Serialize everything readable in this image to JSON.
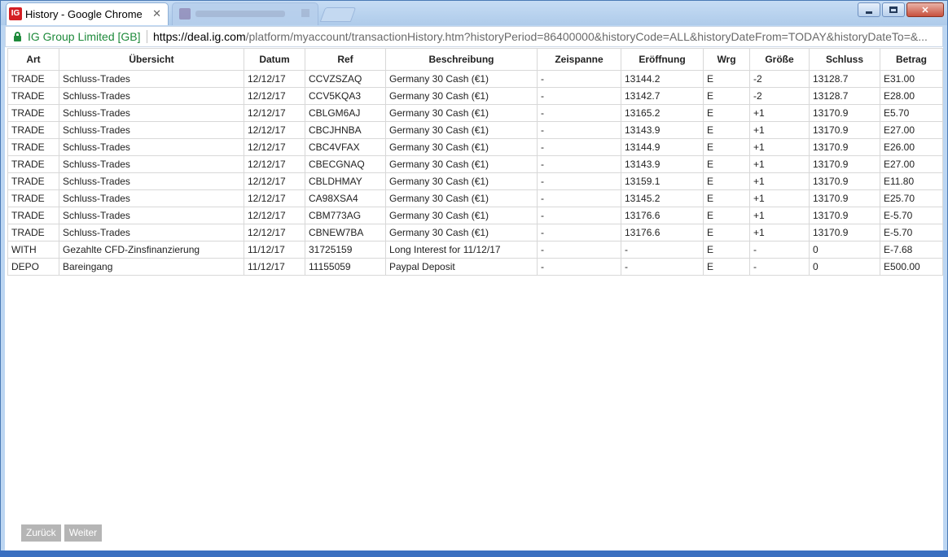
{
  "browser": {
    "active_tab_title": "History - Google Chrome",
    "active_tab_favicon": "IG",
    "site_identity": "IG Group Limited [GB]",
    "url_scheme_host": "https://deal.ig.com",
    "url_path": "/platform/myaccount/transactionHistory.htm?historyPeriod=86400000&historyCode=ALL&historyDateFrom=TODAY&historyDateTo=&..."
  },
  "table": {
    "headers": [
      "Art",
      "Übersicht",
      "Datum",
      "Ref",
      "Beschreibung",
      "Zeispanne",
      "Eröffnung",
      "Wrg",
      "Größe",
      "Schluss",
      "Betrag"
    ],
    "rows": [
      [
        "TRADE",
        "Schluss-Trades",
        "12/12/17",
        "CCVZSZAQ",
        "Germany 30 Cash (€1)",
        "-",
        "13144.2",
        "E",
        "-2",
        "13128.7",
        "E31.00"
      ],
      [
        "TRADE",
        "Schluss-Trades",
        "12/12/17",
        "CCV5KQA3",
        "Germany 30 Cash (€1)",
        "-",
        "13142.7",
        "E",
        "-2",
        "13128.7",
        "E28.00"
      ],
      [
        "TRADE",
        "Schluss-Trades",
        "12/12/17",
        "CBLGM6AJ",
        "Germany 30 Cash (€1)",
        "-",
        "13165.2",
        "E",
        "+1",
        "13170.9",
        "E5.70"
      ],
      [
        "TRADE",
        "Schluss-Trades",
        "12/12/17",
        "CBCJHNBA",
        "Germany 30 Cash (€1)",
        "-",
        "13143.9",
        "E",
        "+1",
        "13170.9",
        "E27.00"
      ],
      [
        "TRADE",
        "Schluss-Trades",
        "12/12/17",
        "CBC4VFAX",
        "Germany 30 Cash (€1)",
        "-",
        "13144.9",
        "E",
        "+1",
        "13170.9",
        "E26.00"
      ],
      [
        "TRADE",
        "Schluss-Trades",
        "12/12/17",
        "CBECGNAQ",
        "Germany 30 Cash (€1)",
        "-",
        "13143.9",
        "E",
        "+1",
        "13170.9",
        "E27.00"
      ],
      [
        "TRADE",
        "Schluss-Trades",
        "12/12/17",
        "CBLDHMAY",
        "Germany 30 Cash (€1)",
        "-",
        "13159.1",
        "E",
        "+1",
        "13170.9",
        "E11.80"
      ],
      [
        "TRADE",
        "Schluss-Trades",
        "12/12/17",
        "CA98XSA4",
        "Germany 30 Cash (€1)",
        "-",
        "13145.2",
        "E",
        "+1",
        "13170.9",
        "E25.70"
      ],
      [
        "TRADE",
        "Schluss-Trades",
        "12/12/17",
        "CBM773AG",
        "Germany 30 Cash (€1)",
        "-",
        "13176.6",
        "E",
        "+1",
        "13170.9",
        "E-5.70"
      ],
      [
        "TRADE",
        "Schluss-Trades",
        "12/12/17",
        "CBNEW7BA",
        "Germany 30 Cash (€1)",
        "-",
        "13176.6",
        "E",
        "+1",
        "13170.9",
        "E-5.70"
      ],
      [
        "WITH",
        "Gezahlte CFD-Zinsfinanzierung",
        "11/12/17",
        "31725159",
        "Long Interest for 11/12/17",
        "-",
        "-",
        "E",
        "-",
        "0",
        "E-7.68"
      ],
      [
        "DEPO",
        "Bareingang",
        "11/12/17",
        "11155059",
        "Paypal Deposit",
        "-",
        "-",
        "E",
        "-",
        "0",
        "E500.00"
      ]
    ]
  },
  "pager": {
    "back_label": "Zurück",
    "next_label": "Weiter"
  },
  "colors": {
    "secure_green": "#1e8a3b",
    "brand_red": "#d41f24",
    "pager_button": "#b5b5b5"
  }
}
